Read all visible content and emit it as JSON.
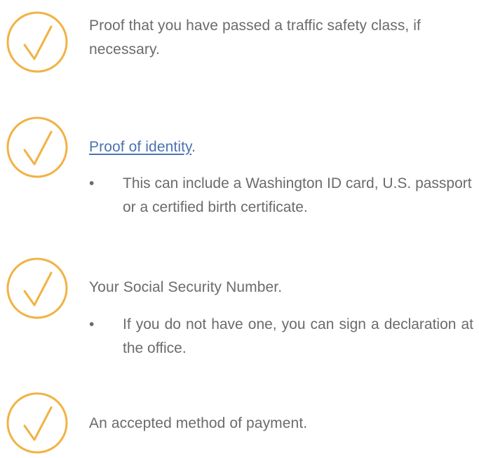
{
  "colors": {
    "check_ring": "#f2b244",
    "text": "#6b6b6b",
    "link": "#4a73b0"
  },
  "items": [
    {
      "icon": "check-circle-icon",
      "text": "Proof that you have passed a traffic safety class, if necessary."
    },
    {
      "icon": "check-circle-icon",
      "link_text": "Proof of identity",
      "suffix": ".",
      "bullet": "This can include a Washington ID card, U.S. passport or a certified birth certificate."
    },
    {
      "icon": "check-circle-icon",
      "text": "Your Social Security Number.",
      "bullet": "If you do not have one, you can sign a declaration at the office."
    },
    {
      "icon": "check-circle-icon",
      "text": "An accepted method of payment."
    }
  ],
  "bullet_symbol": "•"
}
